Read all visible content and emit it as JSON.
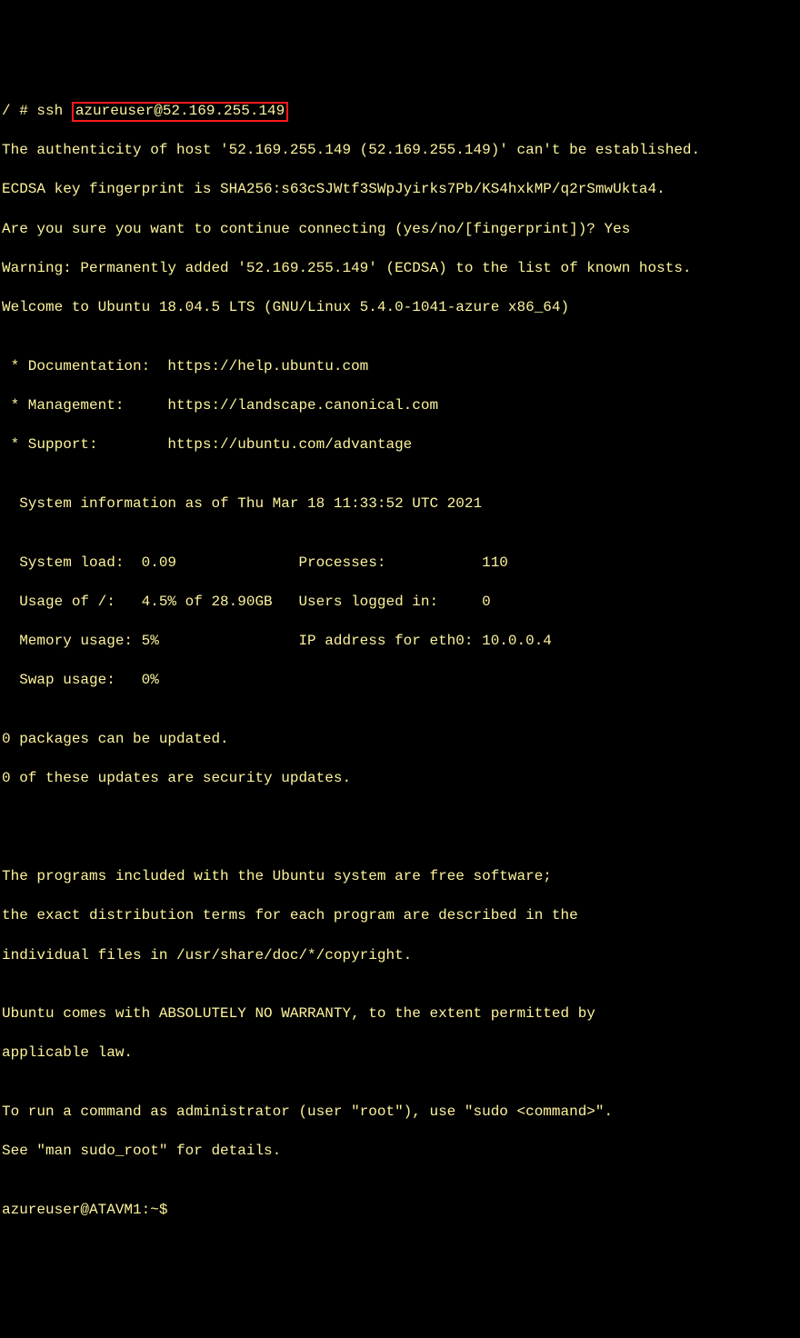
{
  "prompt1": "/ # ssh ",
  "ssh_target": "azureuser@52.169.255.149",
  "line_auth": "The authenticity of host '52.169.255.149 (52.169.255.149)' can't be established.",
  "line_fp": "ECDSA key fingerprint is SHA256:s63cSJWtf3SWpJyirks7Pb/KS4hxkMP/q2rSmwUkta4.",
  "line_confirm": "Are you sure you want to continue connecting (yes/no/[fingerprint])? Yes",
  "line_warn": "Warning: Permanently added '52.169.255.149' (ECDSA) to the list of known hosts.",
  "line_welcome": "Welcome to Ubuntu 18.04.5 LTS (GNU/Linux 5.4.0-1041-azure x86_64)",
  "blank": "",
  "link_doc": " * Documentation:  https://help.ubuntu.com",
  "link_mgmt": " * Management:     https://landscape.canonical.com",
  "link_support": " * Support:        https://ubuntu.com/advantage",
  "sysinfo_header": "  System information as of Thu Mar 18 11:33:52 UTC 2021",
  "stat_row1": "  System load:  0.09              Processes:           110",
  "stat_row2": "  Usage of /:   4.5% of 28.90GB   Users logged in:     0",
  "stat_row3": "  Memory usage: 5%                IP address for eth0: 10.0.0.4",
  "stat_row4": "  Swap usage:   0%",
  "pkg1": "0 packages can be updated.",
  "pkg2": "0 of these updates are security updates.",
  "legal1": "The programs included with the Ubuntu system are free software;",
  "legal2": "the exact distribution terms for each program are described in the",
  "legal3": "individual files in /usr/share/doc/*/copyright.",
  "warranty1": "Ubuntu comes with ABSOLUTELY NO WARRANTY, to the extent permitted by",
  "warranty2": "applicable law.",
  "sudo1": "To run a command as administrator (user \"root\"), use \"sudo <command>\".",
  "sudo2": "See \"man sudo_root\" for details.",
  "prompt2": "azureuser@ATAVM1:~$"
}
